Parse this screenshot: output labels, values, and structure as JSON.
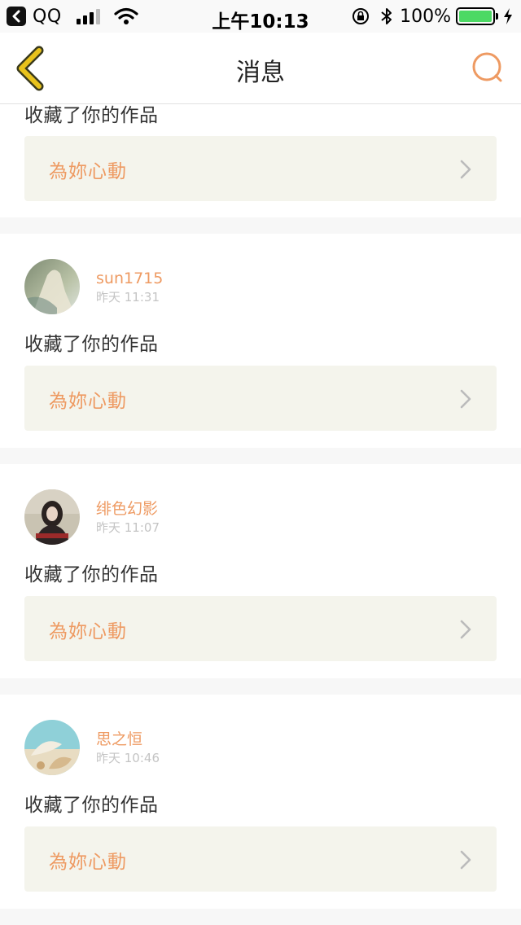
{
  "status_bar": {
    "back_app": "QQ",
    "time": "上午10:13",
    "battery": "100%"
  },
  "nav": {
    "title": "消息",
    "back_icon": "back-chevron-icon",
    "search_icon": "search-icon"
  },
  "messages": [
    {
      "action": "收藏了你的作品",
      "work_title": "為妳心動"
    },
    {
      "username": "sun1715",
      "time": "昨天 11:31",
      "action": "收藏了你的作品",
      "work_title": "為妳心動"
    },
    {
      "username": "绯色幻影",
      "time": "昨天 11:07",
      "action": "收藏了你的作品",
      "work_title": "為妳心動"
    },
    {
      "username": "思之恒",
      "time": "昨天 10:46",
      "action": "收藏了你的作品",
      "work_title": "為妳心動"
    }
  ],
  "colors": {
    "accent": "#ee9a62",
    "back_icon": "#e8c21c",
    "work_box_bg": "#f4f4ec",
    "time_text": "#c4c4c4"
  }
}
